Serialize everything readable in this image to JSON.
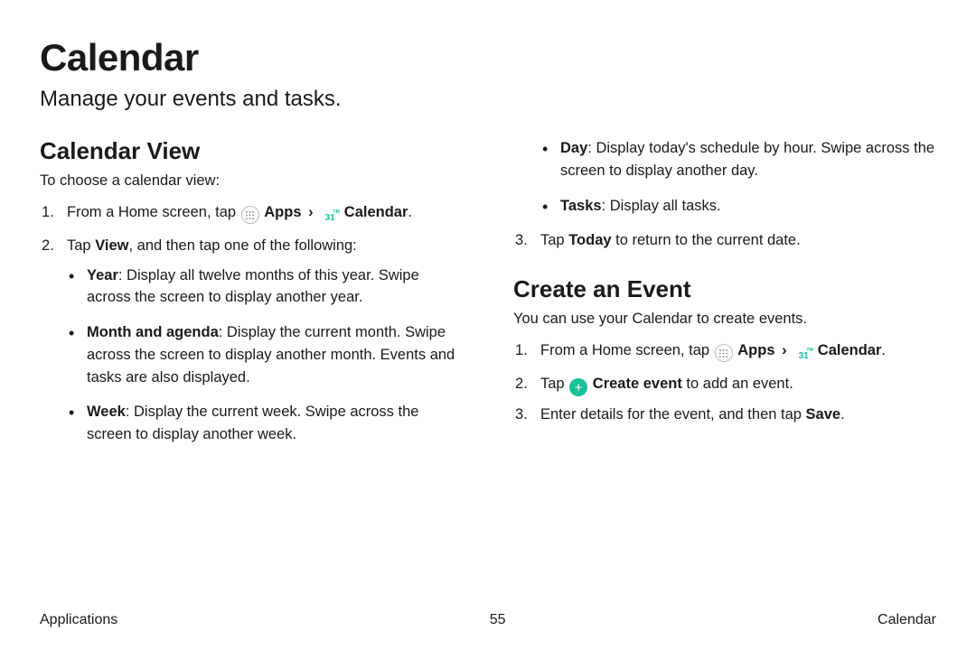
{
  "title": "Calendar",
  "subtitle": "Manage your events and tasks.",
  "left": {
    "heading": "Calendar View",
    "intro": "To choose a calendar view:",
    "step1_pre": "From a Home screen, tap ",
    "apps_label": "Apps",
    "cal_label": "Calendar",
    "cal_icon_text": "31",
    "step2_pre": "Tap ",
    "step2_bold": "View",
    "step2_post": ", and then tap one of the following:",
    "bullets": {
      "year_label": "Year",
      "year_text": ": Display all twelve months of this year. Swipe across the screen to display another year.",
      "month_label": "Month and agenda",
      "month_text": ": Display the current month. Swipe across the screen to display another month. Events and tasks are also displayed.",
      "week_label": "Week",
      "week_text": ": Display the current week. Swipe across the screen to display another week."
    }
  },
  "right": {
    "bullets": {
      "day_label": "Day",
      "day_text": ": Display today's schedule by hour. Swipe across the screen to display another day.",
      "tasks_label": "Tasks",
      "tasks_text": ": Display all tasks."
    },
    "step3_pre": "Tap ",
    "step3_bold": "Today",
    "step3_post": " to return to the current date.",
    "heading2": "Create an Event",
    "intro2": "You can use your Calendar to create events.",
    "e_step1_pre": "From a Home screen, tap ",
    "e_step2_pre": "Tap ",
    "e_step2_bold": "Create event",
    "e_step2_post": " to add an event.",
    "e_step3_pre": "Enter details for the event, and then tap ",
    "e_step3_bold": "Save",
    "e_step3_post": "."
  },
  "footer": {
    "left": "Applications",
    "center": "55",
    "right": "Calendar"
  }
}
